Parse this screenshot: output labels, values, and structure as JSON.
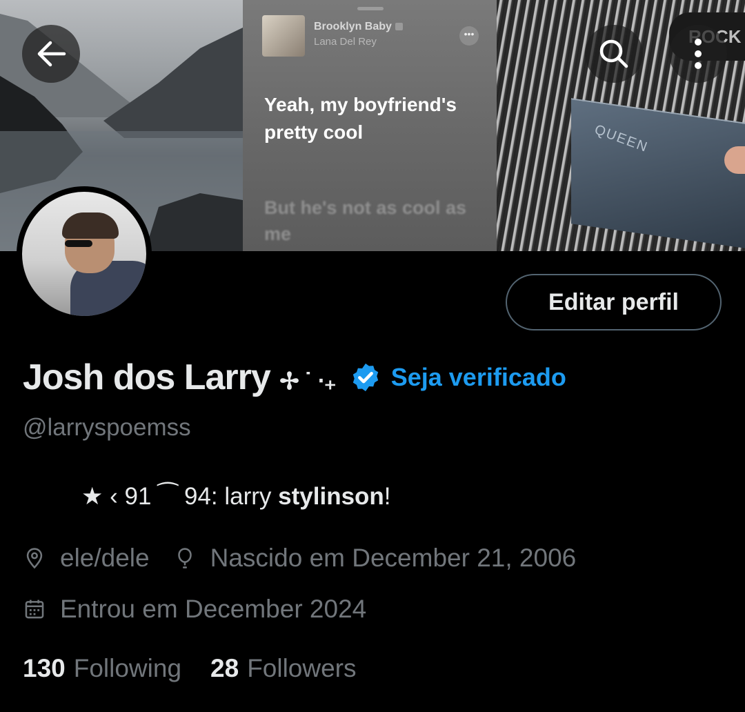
{
  "header": {
    "back_icon": "arrow-left-icon",
    "search_icon": "search-icon",
    "more_icon": "more-vertical-icon"
  },
  "banner": {
    "now_playing": {
      "title": "Brooklyn Baby",
      "artist": "Lana Del Rey",
      "lyric_current": "Yeah, my boyfriend's pretty cool",
      "lyric_next": "But he's not as cool as me"
    },
    "records_sign": "ROCK",
    "sleeve_label": "QUEEN"
  },
  "profile": {
    "edit_button": "Editar perfil",
    "display_name": "Josh dos Larry",
    "name_decoration": "✢ ˙ ‧₊",
    "verify_link": "Seja verificado",
    "handle": "@larryspoemss",
    "bio_prefix": "★ ‹ 91 ⁀ 94: larry ",
    "bio_bold": "stylinson",
    "bio_suffix": "!",
    "pronouns": "ele/dele",
    "birth": "Nascido em December 21, 2006",
    "joined": "Entrou em December 2024"
  },
  "stats": {
    "following_count": "130",
    "following_label": "Following",
    "followers_count": "28",
    "followers_label": "Followers"
  },
  "colors": {
    "accent": "#1d9bf0",
    "secondary_text": "#71767b",
    "primary_text": "#e7e9ea",
    "background": "#000000"
  }
}
